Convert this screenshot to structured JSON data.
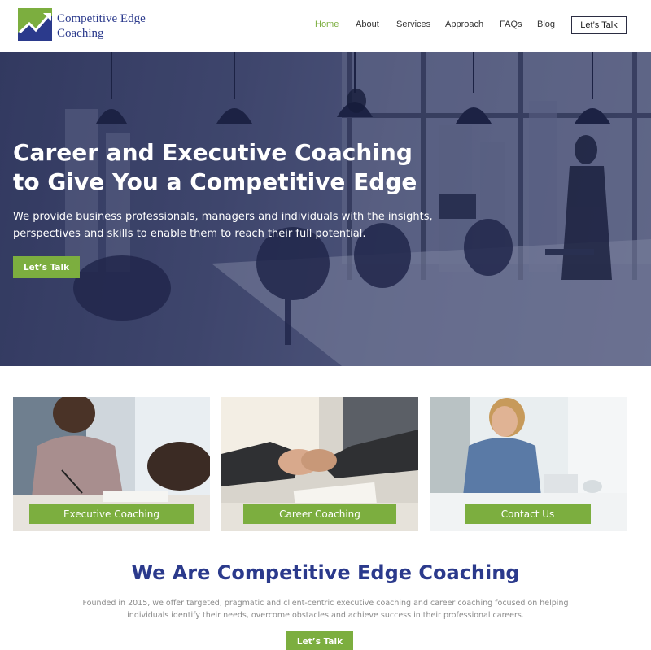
{
  "brand": {
    "name_line1": "Competitive Edge",
    "name_line2": "Coaching",
    "colors": {
      "primary": "#2b3a8c",
      "accent": "#7cae3f"
    },
    "logo_icon": "rising-arrow-chart-icon"
  },
  "nav": {
    "items": [
      {
        "label": "Home",
        "active": true
      },
      {
        "label": "About",
        "active": false
      },
      {
        "label": "Services",
        "active": false
      },
      {
        "label": "Approach",
        "active": false
      },
      {
        "label": "FAQs",
        "active": false
      },
      {
        "label": "Blog",
        "active": false
      }
    ],
    "cta_label": "Let’s Talk"
  },
  "hero": {
    "title_line1": "Career and Executive Coaching",
    "title_line2": "to Give You a Competitive Edge",
    "subtitle_line1": "We provide business professionals, managers and individuals with the insights,",
    "subtitle_line2": "perspectives and skills to enable them to reach their full potential.",
    "button_label": "Let’s Talk"
  },
  "cards": [
    {
      "label": "Executive Coaching"
    },
    {
      "label": "Career Coaching"
    },
    {
      "label": "Contact Us"
    }
  ],
  "about": {
    "title": "We Are Competitive Edge Coaching",
    "text_line1": "Founded in 2015, we offer targeted, pragmatic and client-centric executive coaching and career coaching focused on helping",
    "text_line2": "individuals identify their needs, overcome obstacles and achieve success in their professional careers.",
    "button_label": "Let’s Talk"
  }
}
